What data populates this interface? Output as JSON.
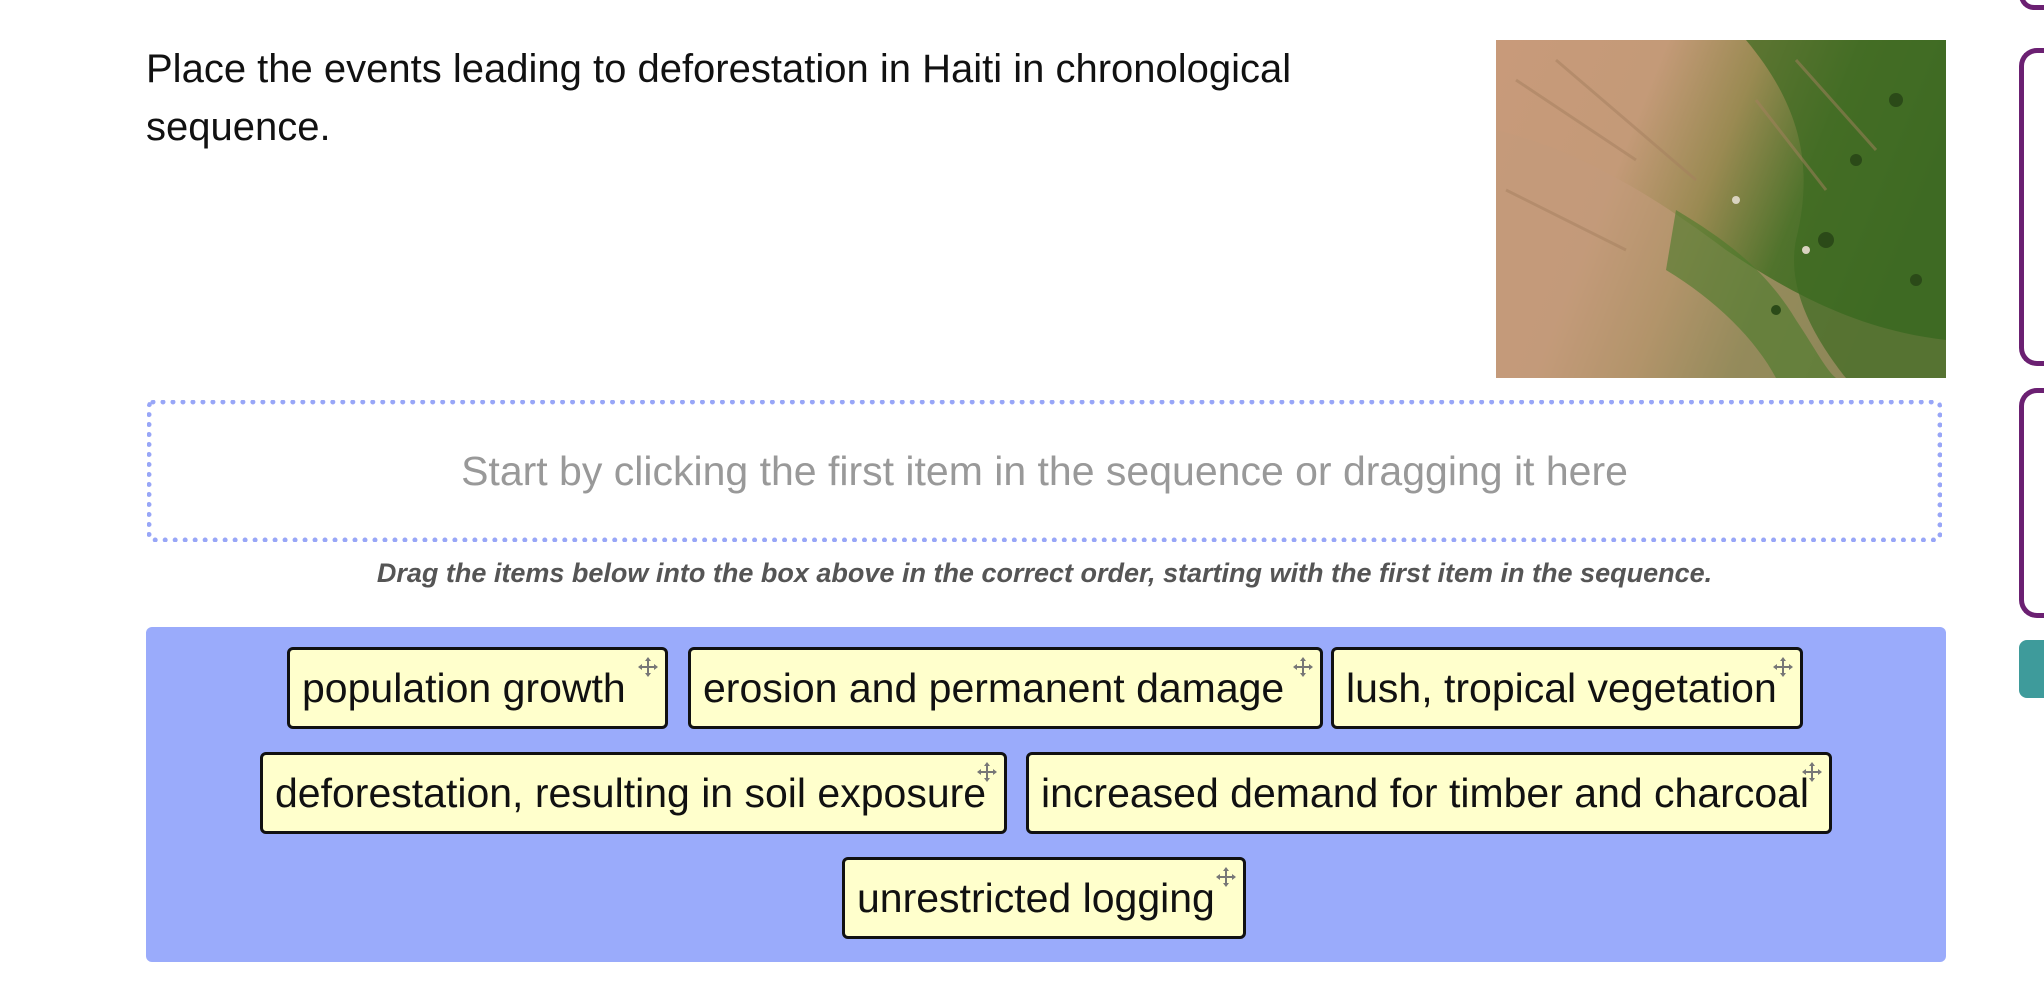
{
  "question": {
    "text": "Place the events leading to deforestation in Haiti in chronological sequence."
  },
  "image": {
    "name": "satellite-image-haiti"
  },
  "dropzone": {
    "hint": "Start by clicking the first item in the sequence or dragging it here"
  },
  "instruction": "Drag the items below into the box above in the correct order, starting with the first item in the sequence.",
  "items": [
    {
      "label": "population growth"
    },
    {
      "label": "erosion and permanent damage"
    },
    {
      "label": "lush, tropical vegetation"
    },
    {
      "label": "deforestation, resulting in soil exposure"
    },
    {
      "label": "increased demand for timber and charcoal"
    },
    {
      "label": "unrestricted logging"
    }
  ],
  "colors": {
    "bank_background": "#9aabfb",
    "dropzone_border": "#98a6f7",
    "chip_background": "#ffffcc",
    "side_card_border": "#6b2072",
    "side_button": "#3e9b9b"
  },
  "icons": {
    "chip_icon": "move-icon"
  }
}
